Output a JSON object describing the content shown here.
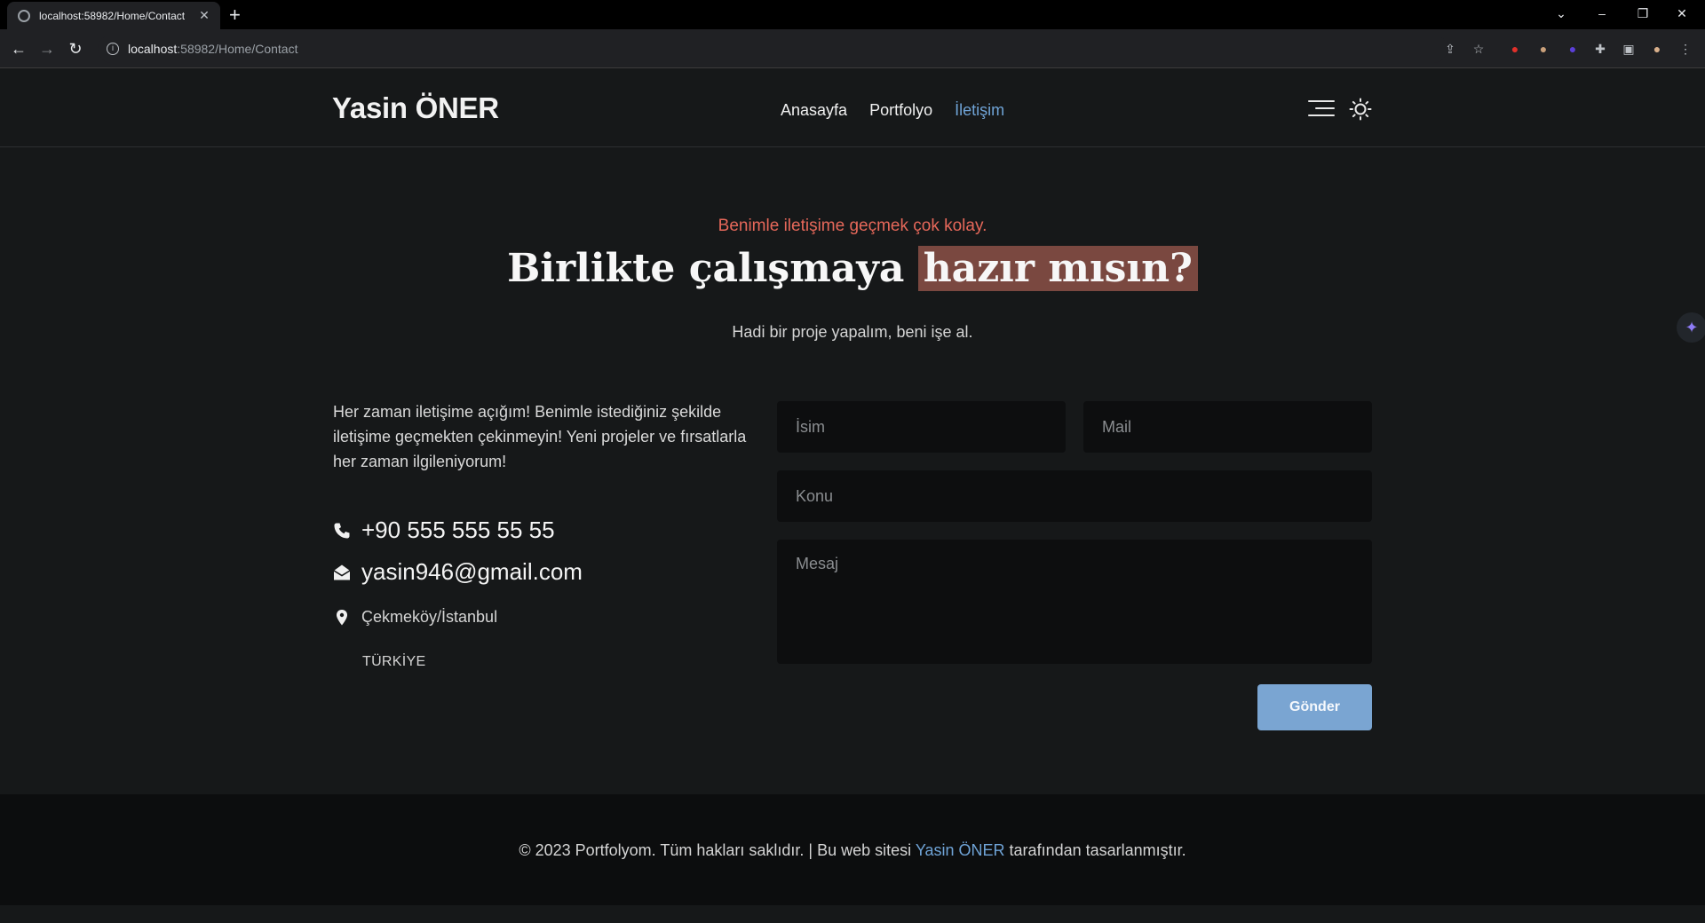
{
  "browser": {
    "tab_title": "localhost:58982/Home/Contact",
    "url_host": "localhost",
    "url_rest": ":58982/Home/Contact"
  },
  "header": {
    "brand": "Yasin ÖNER",
    "nav": [
      {
        "label": "Anasayfa",
        "active": false
      },
      {
        "label": "Portfolyo",
        "active": false
      },
      {
        "label": "İletişim",
        "active": true
      }
    ]
  },
  "hero": {
    "kicker": "Benimle iletişime geçmek çok kolay.",
    "title_plain": "Birlikte çalışmaya",
    "title_highlight": "hazır mısın?",
    "subtitle": "Hadi bir proje yapalım, beni işe al."
  },
  "contact": {
    "intro": "Her zaman iletişime açığım! Benimle istediğiniz şekilde iletişime geçmekten çekinmeyin! Yeni projeler ve fırsatlarla her zaman ilgileniyorum!",
    "phone": "+90 555 555 55 55",
    "email": "yasin946@gmail.com",
    "city": "Çekmeköy/İstanbul",
    "country": "TÜRKİYE"
  },
  "form": {
    "name_placeholder": "İsim",
    "mail_placeholder": "Mail",
    "subject_placeholder": "Konu",
    "message_placeholder": "Mesaj",
    "submit_label": "Gönder"
  },
  "footer": {
    "prefix": "© 2023 Portfolyom. Tüm hakları saklıdır. | Bu web sitesi",
    "author": "Yasin ÖNER",
    "suffix": "tarafından tasarlanmıştır."
  },
  "colors": {
    "accent_blue": "#6fa3d6",
    "kicker_red": "#e6685a",
    "highlight_bg": "#7a4840",
    "button_bg": "#7aa5d2"
  }
}
